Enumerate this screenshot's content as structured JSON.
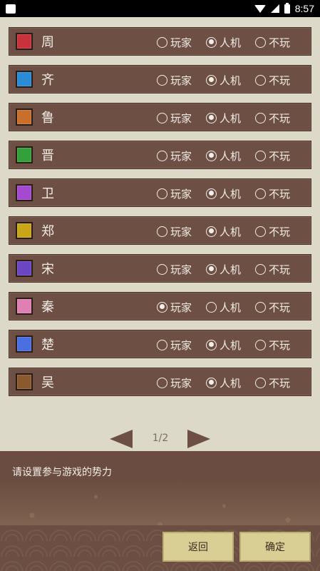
{
  "status_bar": {
    "time": "8:57"
  },
  "rows": [
    {
      "name": "周",
      "color": "#c9323a",
      "selected": 1
    },
    {
      "name": "齐",
      "color": "#2a8bd6",
      "selected": 1
    },
    {
      "name": "鲁",
      "color": "#c8702b",
      "selected": 1
    },
    {
      "name": "晋",
      "color": "#33a13a",
      "selected": 1
    },
    {
      "name": "卫",
      "color": "#a54ad0",
      "selected": 1
    },
    {
      "name": "郑",
      "color": "#c9a617",
      "selected": 1
    },
    {
      "name": "宋",
      "color": "#6a46c2",
      "selected": 1
    },
    {
      "name": "秦",
      "color": "#e07fb3",
      "selected": 0
    },
    {
      "name": "楚",
      "color": "#4b6fe0",
      "selected": 1
    },
    {
      "name": "吴",
      "color": "#8a5a2e",
      "selected": 1
    }
  ],
  "option_labels": [
    "玩家",
    "人机",
    "不玩"
  ],
  "pager": {
    "page": "1/2"
  },
  "hint": "请设置参与游戏的势力",
  "buttons": {
    "back": "返回",
    "ok": "确定"
  }
}
